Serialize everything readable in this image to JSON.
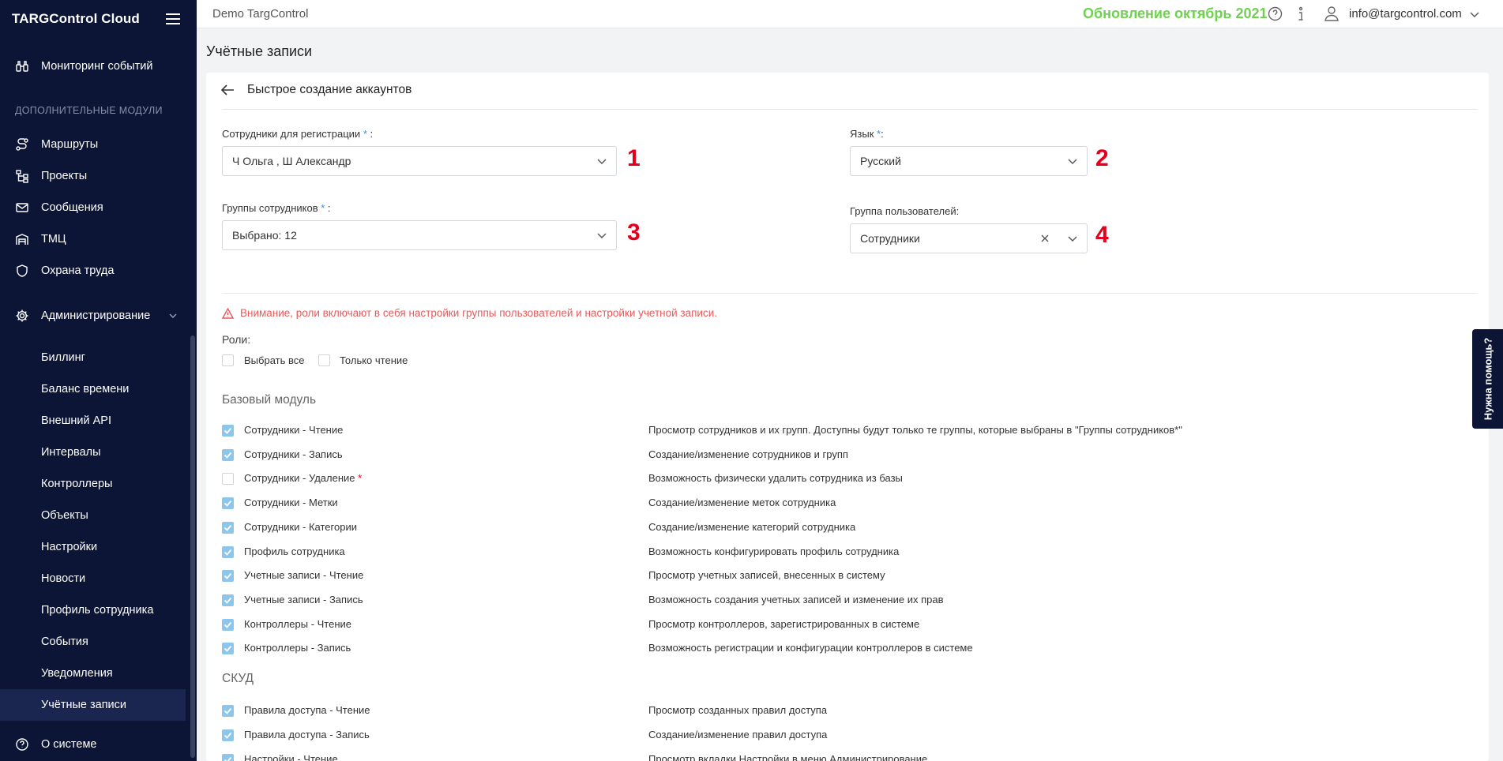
{
  "sidebar": {
    "brand": "TARGControl Cloud",
    "monitoring": "Мониторинг событий",
    "section_label": "ДОПОЛНИТЕЛЬНЫЕ МОДУЛИ",
    "modules": [
      "Маршруты",
      "Проекты",
      "Сообщения",
      "ТМЦ",
      "Охрана труда"
    ],
    "admin": "Администрирование",
    "admin_items": [
      "Биллинг",
      "Баланс времени",
      "Внешний API",
      "Интервалы",
      "Контроллеры",
      "Объекты",
      "Настройки",
      "Новости",
      "Профиль сотрудника",
      "События",
      "Уведомления",
      "Учётные записи"
    ],
    "about": "О системе"
  },
  "topbar": {
    "company": "Demo TargControl",
    "update": "Обновление октябрь 2021",
    "email": "info@targcontrol.com"
  },
  "page_title": "Учётные записи",
  "card": {
    "title": "Быстрое создание аккаунтов",
    "employees_label": "Сотрудники для регистрации",
    "employees_value": "Ч Ольга , Ш Александр",
    "language_label": "Язык",
    "language_value": "Русский",
    "groups_label": "Группы сотрудников",
    "groups_value": "Выбрано: 12",
    "user_group_label": "Группа пользователей:",
    "user_group_value": "Сотрудники",
    "markers": [
      "1",
      "2",
      "3",
      "4"
    ],
    "warning": "Внимание, роли включают в себя настройки группы пользователей и настройки учетной записи.",
    "roles_label": "Роли:",
    "select_all": "Выбрать все",
    "read_only": "Только чтение",
    "base_module": "Базовый модуль",
    "base_perms": [
      {
        "name": "Сотрудники - Чтение",
        "desc": "Просмотр сотрудников и их групп. Доступны будут только те группы, которые выбраны в \"Группы сотрудников*\""
      },
      {
        "name": "Сотрудники - Запись",
        "desc": "Создание/изменение сотрудников и групп"
      },
      {
        "name": "Сотрудники - Удаление",
        "desc": "Возможность физически удалить сотрудника из базы"
      },
      {
        "name": "Сотрудники - Метки",
        "desc": "Создание/изменение меток сотрудника"
      },
      {
        "name": "Сотрудники - Категории",
        "desc": "Создание/изменение категорий сотрудника"
      },
      {
        "name": "Профиль сотрудника",
        "desc": "Возможность конфигурировать профиль сотрудника"
      },
      {
        "name": "Учетные записи - Чтение",
        "desc": "Просмотр учетных записей, внесенных в систему"
      },
      {
        "name": "Учетные записи - Запись",
        "desc": "Возможность создания учетных записей и изменение их прав"
      },
      {
        "name": "Контроллеры - Чтение",
        "desc": "Просмотр контроллеров, зарегистрированных в системе"
      },
      {
        "name": "Контроллеры - Запись",
        "desc": "Возможность регистрации и конфигурации контроллеров в системе"
      }
    ],
    "skud": "СКУД",
    "skud_perms": [
      {
        "name": "Правила доступа - Чтение",
        "desc": "Просмотр созданных правил доступа"
      },
      {
        "name": "Правила доступа - Запись",
        "desc": "Создание/изменение правил доступа"
      },
      {
        "name": "Настройки - Чтение",
        "desc": "Просмотр вкладки Настройки в меню Администрирование"
      }
    ]
  },
  "help_tab": "Нужна помощь?",
  "colors": {
    "sidebar": "#0c1535",
    "accent_green": "#6ed24e",
    "marker_red": "#e4001c",
    "checkbox": "#8cc6ec"
  }
}
